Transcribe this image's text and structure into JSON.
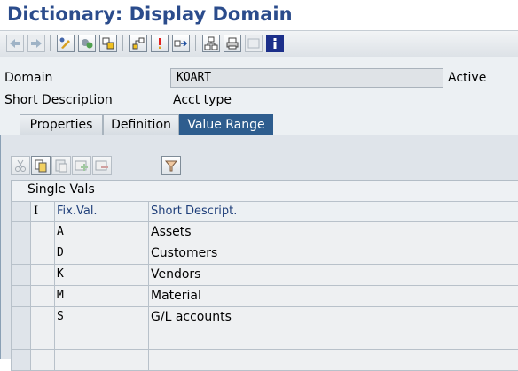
{
  "window": {
    "title": "Dictionary: Display Domain"
  },
  "toolbar": {
    "icons": [
      "back-icon",
      "forward-icon",
      "toggle-change-display-icon",
      "other-object-icon",
      "activate-icon",
      "where-used-icon",
      "info-icon",
      "navigation-icon",
      "hierarchy-icon",
      "print-icon",
      "display-object-list-icon",
      "help-info-icon"
    ]
  },
  "header": {
    "domain_label": "Domain",
    "domain_value": "KOART",
    "status": "Active",
    "short_desc_label": "Short Description",
    "short_desc_value": "Acct type"
  },
  "tabs": [
    {
      "label": "Properties",
      "active": false
    },
    {
      "label": "Definition",
      "active": false
    },
    {
      "label": "Value Range",
      "active": true
    }
  ],
  "value_table": {
    "toolbar_icons": [
      "cut-icon",
      "copy-icon",
      "paste-icon",
      "insert-row-icon",
      "delete-row-icon",
      "filter-icon"
    ],
    "title": "Single Vals",
    "columns": {
      "indicator": "I",
      "fix_val": "Fix.Val.",
      "short_descript": "Short Descript."
    },
    "rows": [
      {
        "fix_val": "A",
        "short_descript": "Assets"
      },
      {
        "fix_val": "D",
        "short_descript": "Customers"
      },
      {
        "fix_val": "K",
        "short_descript": "Vendors"
      },
      {
        "fix_val": "M",
        "short_descript": "Material"
      },
      {
        "fix_val": "S",
        "short_descript": "G/L accounts"
      },
      {
        "fix_val": "",
        "short_descript": ""
      },
      {
        "fix_val": "",
        "short_descript": ""
      }
    ]
  },
  "colors": {
    "title": "#2b4c8c",
    "active_tab": "#2e5d8e",
    "column_header": "#1f3f7a"
  }
}
